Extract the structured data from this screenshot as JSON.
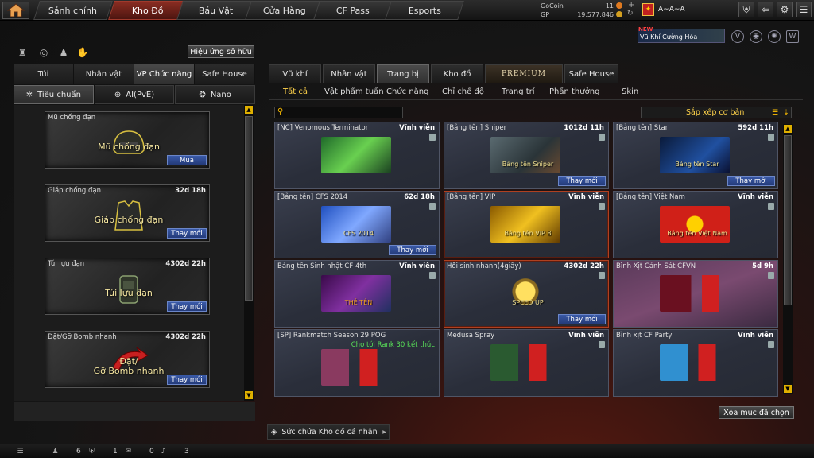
{
  "topbar": {
    "tabs": [
      "Sảnh chính",
      "Kho Đồ",
      "Báu Vật",
      "Cửa Hàng",
      "CF Pass",
      "Esports"
    ],
    "gocoin_label": "GoCoin",
    "gocoin_value": "11",
    "gp_label": "GP",
    "gp_value": "19,577,846",
    "username": "A~A~A",
    "icons": [
      "shield-icon",
      "exit-icon",
      "settings-icon",
      "menu-icon"
    ]
  },
  "left": {
    "effect_button": "Hiệu ứng sở hữu",
    "tabs": [
      "Túi",
      "Nhân vật",
      "VP Chức năng",
      "Safe House"
    ],
    "subtabs": [
      "Tiêu chuẩn",
      "AI(PvE)",
      "Nano"
    ],
    "items": [
      {
        "name": "Mũ chống đạn",
        "label": "Mũ chống đạn",
        "time": "",
        "button": "Mua"
      },
      {
        "name": "Giáp chống đạn",
        "label": "Giáp chống đạn",
        "time": "32d 18h",
        "button": "Thay mới"
      },
      {
        "name": "Túi lựu đạn",
        "label": "Túi lựu đạn",
        "time": "4302d 22h",
        "button": "Thay mới"
      },
      {
        "name": "Đặt/Gỡ Bomb nhanh",
        "label": "Đặt/\nGỡ Bomb nhanh",
        "time": "4302d 22h",
        "button": "Thay mới"
      }
    ]
  },
  "right": {
    "promo_new": "NEW",
    "promo_text": "Vũ Khí Cường Hóa",
    "tabs": [
      "Vũ khí",
      "Nhân vật",
      "Trang bị",
      "Kho đồ",
      "PREMIUM",
      "Safe House"
    ],
    "subtabs": [
      "Tất cả",
      "Vật phẩm tuần",
      "Chức năng",
      "Chỉ chế độ",
      "Trang trí",
      "Phần thưởng",
      "Skin"
    ],
    "sort_label": "Sắp xếp cơ bản",
    "cards": [
      {
        "name": "[NC] Venomous Terminator",
        "time": "Vĩnh viễn",
        "art_label": "",
        "button": ""
      },
      {
        "name": "[Bảng tên] Sniper",
        "time": "1012d 11h",
        "art_label": "Bảng tên Sniper",
        "button": "Thay mới"
      },
      {
        "name": "[Bảng tên] Star",
        "time": "592d 11h",
        "art_label": "Bảng tên Star",
        "button": "Thay mới"
      },
      {
        "name": "[Bảng tên] CFS 2014",
        "time": "62d 18h",
        "art_label": "CFS 2014",
        "button": "Thay mới"
      },
      {
        "name": "[Bảng tên] VIP",
        "time": "Vĩnh viễn",
        "art_label": "Bảng tên VIP 8",
        "button": ""
      },
      {
        "name": "[Bảng tên] Việt Nam",
        "time": "Vĩnh viễn",
        "art_label": "Bảng tên Việt Nam",
        "button": ""
      },
      {
        "name": "Bảng tên Sinh nhật CF 4th",
        "time": "Vĩnh viễn",
        "art_label": "THẺ TÊN",
        "button": ""
      },
      {
        "name": "Hồi sinh nhanh(4giây)",
        "time": "4302d 22h",
        "art_label": "SPEED UP",
        "button": "Thay mới"
      },
      {
        "name": "Bình Xịt Cảnh Sát CFVN",
        "time": "5d 9h",
        "art_label": "",
        "button": ""
      },
      {
        "name": "[SP] Rankmatch Season 29 POG",
        "time": "",
        "note": "Cho tới Rank 30 kết thúc",
        "art_label": "",
        "button": ""
      },
      {
        "name": "Medusa Spray",
        "time": "Vĩnh viễn",
        "art_label": "",
        "button": ""
      },
      {
        "name": "Bình xịt CF Party",
        "time": "Vĩnh viễn",
        "art_label": "",
        "button": ""
      }
    ],
    "clear_button": "Xóa mục đã chọn",
    "capacity_label": "Sức chứa Kho đồ cá nhân"
  },
  "statusbar": {
    "count1": "6",
    "count2": "1",
    "count3": "0",
    "count4": "3"
  }
}
